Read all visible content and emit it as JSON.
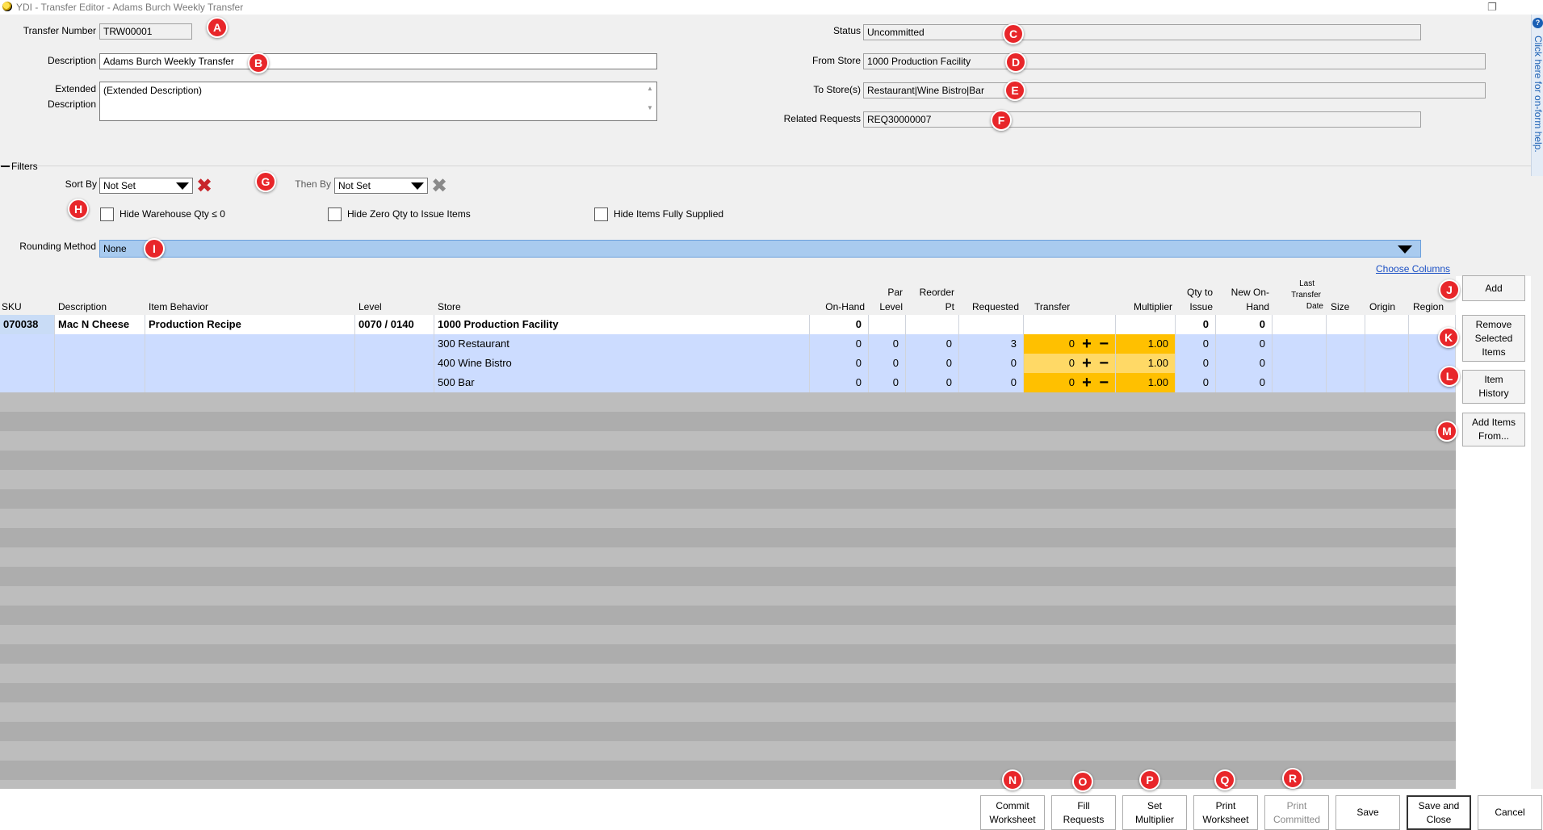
{
  "window": {
    "title": "YDI - Transfer Editor - Adams Burch Weekly Transfer"
  },
  "form": {
    "transfer_number_label": "Transfer Number",
    "transfer_number": "TRW00001",
    "description_label": "Description",
    "description": "Adams Burch Weekly Transfer",
    "extended_description_label_1": "Extended",
    "extended_description_label_2": "Description",
    "extended_description": "(Extended Description)",
    "status_label": "Status",
    "status": "Uncommitted",
    "from_store_label": "From Store",
    "from_store": "1000 Production Facility",
    "to_stores_label": "To Store(s)",
    "to_stores": "Restaurant|Wine Bistro|Bar",
    "related_requests_label": "Related Requests",
    "related_requests": "REQ30000007"
  },
  "help_tab": {
    "text": "Click here for on-form help."
  },
  "filters": {
    "section_label": "Filters",
    "sort_by_label": "Sort By",
    "sort_by_value": "Not Set",
    "then_by_label": "Then By",
    "then_by_value": "Not Set",
    "hide_warehouse_label": "Hide Warehouse Qty ≤ 0",
    "hide_zero_label": "Hide Zero Qty to Issue Items",
    "hide_supplied_label": "Hide Items Fully Supplied",
    "rounding_label": "Rounding Method",
    "rounding_value": "None"
  },
  "choose_columns": "Choose Columns",
  "grid": {
    "columns": {
      "sku": "SKU",
      "description": "Description",
      "item_behavior": "Item Behavior",
      "level": "Level",
      "store": "Store",
      "on_hand": "On-Hand",
      "par_level_1": "Par",
      "par_level_2": "Level",
      "reorder_pt_1": "Reorder",
      "reorder_pt_2": "Pt",
      "requested": "Requested",
      "transfer": "Transfer",
      "multiplier": "Multiplier",
      "qty_issue_1": "Qty to",
      "qty_issue_2": "Issue",
      "new_onhand_1": "New On-",
      "new_onhand_2": "Hand",
      "last_transfer_1": "Last",
      "last_transfer_2": "Transfer",
      "last_transfer_3": "Date",
      "size": "Size",
      "origin": "Origin",
      "region": "Region"
    },
    "parent": {
      "sku": "070038",
      "description": "Mac N Cheese",
      "item_behavior": "Production Recipe",
      "level": "0070 / 0140",
      "store": "1000 Production Facility",
      "on_hand": "0",
      "qty_issue": "0",
      "new_onhand": "0"
    },
    "children": [
      {
        "store": "300 Restaurant",
        "on_hand": "0",
        "par": "0",
        "reorder": "0",
        "requested": "3",
        "transfer": "0",
        "multiplier": "1.00",
        "qty_issue": "0",
        "new_onhand": "0"
      },
      {
        "store": "400 Wine Bistro",
        "on_hand": "0",
        "par": "0",
        "reorder": "0",
        "requested": "0",
        "transfer": "0",
        "multiplier": "1.00",
        "qty_issue": "0",
        "new_onhand": "0"
      },
      {
        "store": "500 Bar",
        "on_hand": "0",
        "par": "0",
        "reorder": "0",
        "requested": "0",
        "transfer": "0",
        "multiplier": "1.00",
        "qty_issue": "0",
        "new_onhand": "0"
      }
    ],
    "plus_minus": "+ −"
  },
  "side_buttons": {
    "add": "Add",
    "remove_1": "Remove",
    "remove_2": "Selected",
    "remove_3": "Items",
    "history_1": "Item",
    "history_2": "History",
    "add_from_1": "Add Items",
    "add_from_2": "From..."
  },
  "bottom_buttons": {
    "commit_1": "Commit",
    "commit_2": "Worksheet",
    "fill_1": "Fill",
    "fill_2": "Requests",
    "setmult_1": "Set",
    "setmult_2": "Multiplier",
    "print_ws_1": "Print",
    "print_ws_2": "Worksheet",
    "print_c_1": "Print",
    "print_c_2": "Committed",
    "save": "Save",
    "save_close_1": "Save and",
    "save_close_2": "Close",
    "cancel": "Cancel"
  },
  "callouts": [
    "A",
    "B",
    "C",
    "D",
    "E",
    "F",
    "G",
    "H",
    "I",
    "J",
    "K",
    "L",
    "M",
    "N",
    "O",
    "P",
    "Q",
    "R"
  ],
  "colors": {
    "callout": "#e8262a",
    "transfer_cell": "#ffc000",
    "child_row": "#ccdcff",
    "rounding_bg": "#a9cbef"
  }
}
